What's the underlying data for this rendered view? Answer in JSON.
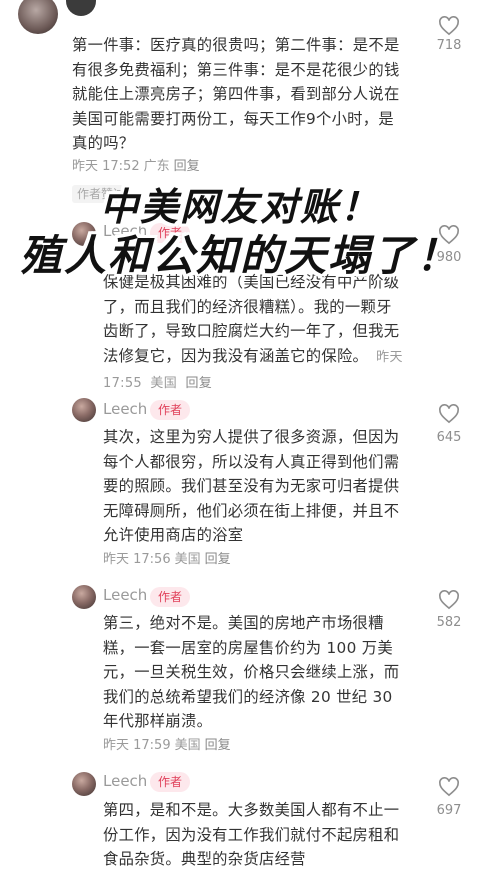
{
  "comments": [
    {
      "text": "第一件事：医疗真的很贵吗；第二件事：是不是有很多免费福利；第三件事：是不是花很少的钱就能住上漂亮房子；第四件事，看到部分人说在美国可能需要打两份工，每天工作9个小时，是真的吗？",
      "time": "昨天 17:52",
      "location": "广东",
      "reply": "回复",
      "likes": "718"
    },
    {
      "tag": "作者赞过",
      "name": "Leech",
      "badge": "作者",
      "text": "保健是极其困难的（美国已经没有中产阶级了，而且我们的经济很糟糕）。我的一颗牙齿断了，导致口腔腐烂大约一年了，但我无法修复它，因为我没有涵盖它的保险。",
      "time": "昨天 17:55",
      "location": "美国",
      "reply": "回复",
      "likes": "980"
    },
    {
      "name": "Leech",
      "badge": "作者",
      "text": "其次，这里为穷人提供了很多资源，但因为每个人都很穷，所以没有人真正得到他们需要的照顾。我们甚至没有为无家可归者提供无障碍厕所，他们必须在街上排便，并且不允许使用商店的浴室",
      "time": "昨天 17:56",
      "location": "美国",
      "reply": "回复",
      "likes": "645"
    },
    {
      "name": "Leech",
      "badge": "作者",
      "text": "第三，绝对不是。美国的房地产市场很糟糕，一套一居室的房屋售价约为 100 万美元，一旦关税生效，价格只会继续上涨，而我们的总统希望我们的经济像 20 世纪 30 年代那样崩溃。",
      "time": "昨天 17:59",
      "location": "美国",
      "reply": "回复",
      "likes": "582"
    },
    {
      "name": "Leech",
      "badge": "作者",
      "text": "第四，是和不是。大多数美国人都有不止一份工作，因为没有工作我们就付不起房租和食品杂货。典型的杂货店经营",
      "likes": "697"
    }
  ],
  "overlay": {
    "line1": "中美网友对账！",
    "line2": "殖人和公知的天塌了！"
  }
}
